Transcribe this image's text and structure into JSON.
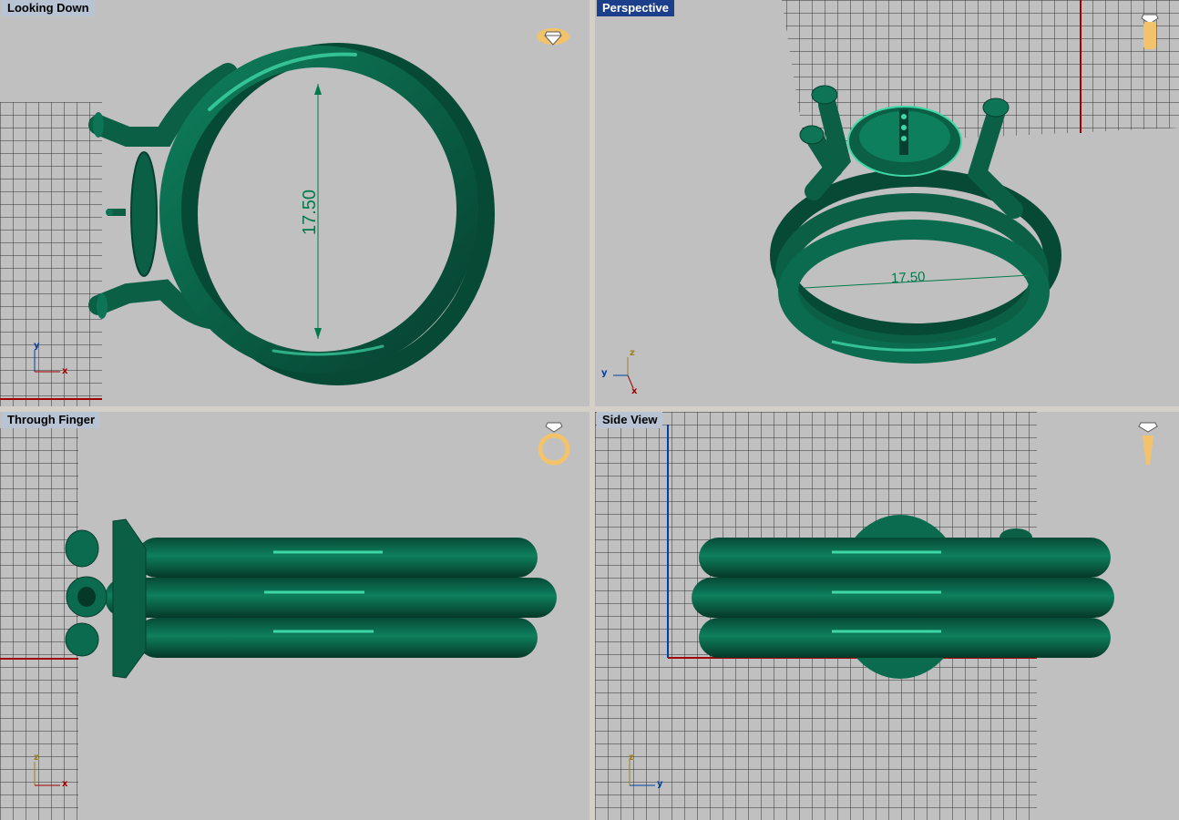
{
  "viewports": {
    "top": {
      "title": "Looking Down",
      "icon": "diamond-top-icon"
    },
    "perspective": {
      "title": "Perspective",
      "icon": "ring-upright-icon"
    },
    "front": {
      "title": "Through Finger",
      "icon": "ring-front-icon"
    },
    "side": {
      "title": "Side View",
      "icon": "ring-side-icon"
    }
  },
  "dimension": {
    "value": "17.50"
  },
  "axes": {
    "x": "x",
    "y": "y",
    "z": "z"
  },
  "colors": {
    "viewport_bg": "#c0c0c0",
    "grid": "#303030",
    "ring": "#0b6b4e",
    "ring_highlight": "#3fd7a6",
    "axis_x": "#a00000",
    "axis_y": "#0040a0",
    "dimension": "#007a4a",
    "active_title_bg": "#1c3f8c"
  }
}
